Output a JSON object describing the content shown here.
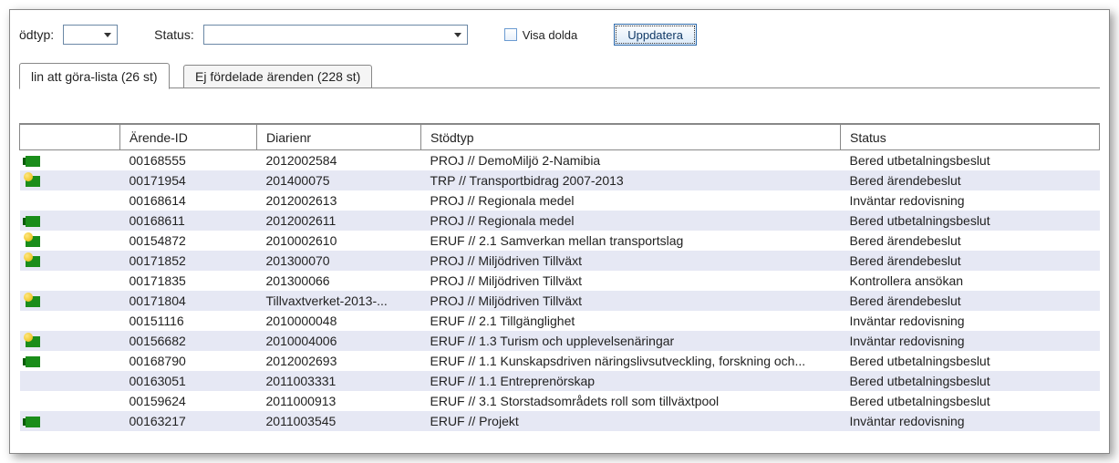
{
  "filter": {
    "typeLabel": "ödtyp:",
    "statusLabel": "Status:",
    "showHiddenLabel": "Visa dolda",
    "updateLabel": "Uppdatera"
  },
  "tabs": {
    "t1": "lin att göra-lista (26 st)",
    "t2": "Ej fördelade ärenden (228 st)"
  },
  "columns": {
    "icon": "",
    "id": "Ärende-ID",
    "dnr": "Diarienr",
    "type": "Stödtyp",
    "status": "Status"
  },
  "rows": [
    {
      "icon": "green",
      "id": "00168555",
      "dnr": "2012002584",
      "type": "PROJ // DemoMiljö 2-Namibia",
      "status": "Bered utbetalningsbeslut"
    },
    {
      "icon": "yellow",
      "id": "00171954",
      "dnr": "201400075",
      "type": "TRP // Transportbidrag 2007-2013",
      "status": "Bered ärendebeslut"
    },
    {
      "icon": "",
      "id": "00168614",
      "dnr": "2012002613",
      "type": "PROJ // Regionala medel",
      "status": "Inväntar redovisning"
    },
    {
      "icon": "green",
      "id": "00168611",
      "dnr": "2012002611",
      "type": "PROJ // Regionala medel",
      "status": "Bered utbetalningsbeslut"
    },
    {
      "icon": "yellow",
      "id": "00154872",
      "dnr": "2010002610",
      "type": "ERUF // 2.1 Samverkan mellan transportslag",
      "status": "Bered ärendebeslut"
    },
    {
      "icon": "yellow",
      "id": "00171852",
      "dnr": "201300070",
      "type": "PROJ // Miljödriven Tillväxt",
      "status": "Bered ärendebeslut"
    },
    {
      "icon": "",
      "id": "00171835",
      "dnr": "201300066",
      "type": "PROJ // Miljödriven Tillväxt",
      "status": "Kontrollera ansökan"
    },
    {
      "icon": "yellow",
      "id": "00171804",
      "dnr": "Tillvaxtverket-2013-...",
      "type": "PROJ // Miljödriven Tillväxt",
      "status": "Bered ärendebeslut"
    },
    {
      "icon": "",
      "id": "00151116",
      "dnr": "2010000048",
      "type": "ERUF // 2.1 Tillgänglighet",
      "status": "Inväntar redovisning"
    },
    {
      "icon": "yellow",
      "id": "00156682",
      "dnr": "2010004006",
      "type": "ERUF // 1.3 Turism och upplevelsenäringar",
      "status": "Inväntar redovisning"
    },
    {
      "icon": "green",
      "id": "00168790",
      "dnr": "2012002693",
      "type": "ERUF // 1.1 Kunskapsdriven näringslivsutveckling, forskning och...",
      "status": "Bered utbetalningsbeslut"
    },
    {
      "icon": "",
      "id": "00163051",
      "dnr": "2011003331",
      "type": "ERUF // 1.1 Entreprenörskap",
      "status": "Bered utbetalningsbeslut"
    },
    {
      "icon": "",
      "id": "00159624",
      "dnr": "2011000913",
      "type": "ERUF // 3.1 Storstadsområdets roll som tillväxtpool",
      "status": "Bered utbetalningsbeslut"
    },
    {
      "icon": "green",
      "id": "00163217",
      "dnr": "2011003545",
      "type": "ERUF // Projekt",
      "status": "Inväntar redovisning"
    }
  ]
}
